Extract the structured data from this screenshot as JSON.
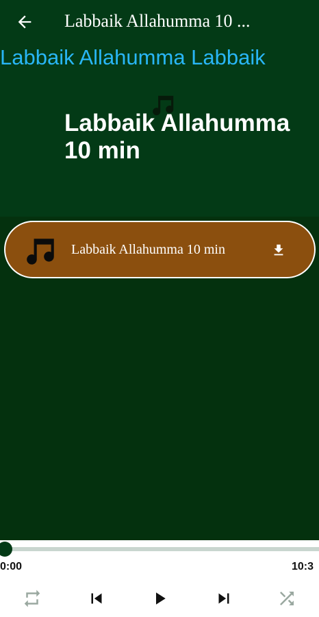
{
  "app_bar": {
    "title": "Labbaik Allahumma 10 ...",
    "back_icon": "arrow-left-icon"
  },
  "header": {
    "marquee_text": "Labbaik Allahumma Labbaik",
    "track_title": "Labbaik Allahumma 10 min",
    "icon": "music-note-icon"
  },
  "track_list": [
    {
      "label": "Labbaik Allahumma 10 min",
      "icon": "music-note-icon",
      "action_icon": "download-icon"
    }
  ],
  "player": {
    "current_time": "0:00",
    "total_time": "10:3",
    "progress": 0,
    "controls": [
      "repeat-icon",
      "skip-previous-icon",
      "play-icon",
      "skip-next-icon",
      "shuffle-icon"
    ]
  },
  "colors": {
    "app_bar_bg": "#033a16",
    "content_bg": "#04310e",
    "marquee": "#29b6f6",
    "card_bg": "#8b4f0e",
    "seek_track": "#c9d6cf"
  }
}
